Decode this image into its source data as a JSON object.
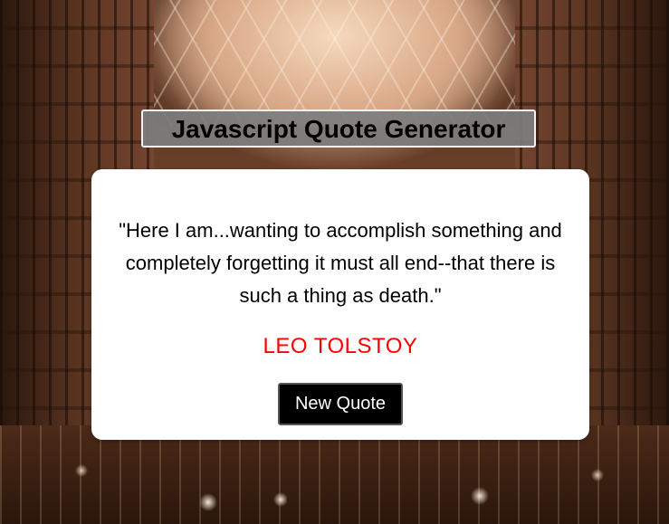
{
  "header": {
    "title": "Javascript Quote Generator"
  },
  "quote_card": {
    "quote_text": "\"Here I am...wanting to accomplish something and completely forgetting it must all end--that there is such a thing as death.\"",
    "author": "LEO TOLSTOY",
    "new_quote_label": "New Quote"
  },
  "colors": {
    "author": "#ff0000",
    "button_bg": "#000000",
    "card_bg": "#ffffff",
    "title_bg": "#7d7d7d"
  }
}
